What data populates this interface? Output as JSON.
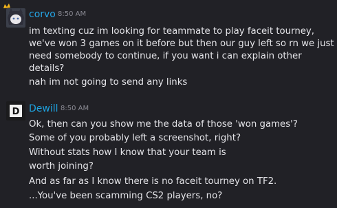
{
  "messages": [
    {
      "author": "corvo",
      "author_color": "#25a5e5",
      "time": "8:50 AM",
      "avatar": "anime-cat-avatar-with-crown",
      "lines": [
        "im texting cuz im looking for teammate to play faceit tourney,",
        "we've won 3 games on it before but then our guy left so rn we just",
        "need somebody to continue, if you want i can explain other",
        "details?",
        "nah im not going to send any links"
      ]
    },
    {
      "author": "Dewill",
      "author_color": "#1ea3e0",
      "time": "8:50 AM",
      "avatar": "d-letter-avatar",
      "lines": [
        "Ok, then can you show me the data of those 'won games'?",
        "Some of you probably left a screenshot, right?",
        "Without stats how I know that your team is",
        "worth joining?",
        "And as far as I know there is no faceit tourney on TF2.",
        "...You've been scamming CS2 players, no?"
      ]
    }
  ]
}
